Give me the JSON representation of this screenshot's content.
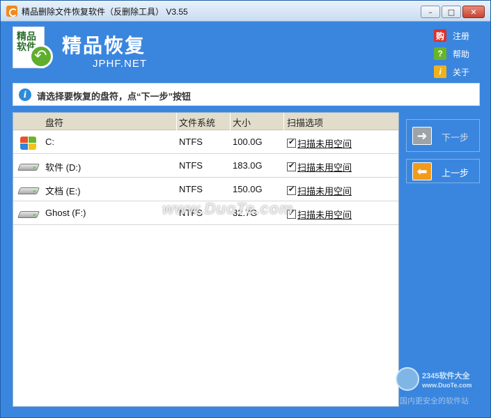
{
  "window": {
    "title": "精品删除文件恢复软件（反删除工具） V3.55"
  },
  "header": {
    "logo_text": "精品软件",
    "brand": "精品恢复",
    "brand_sub": "JPHF.NET",
    "links": [
      {
        "label": "注册",
        "icon": "cart-icon",
        "glyph": "购"
      },
      {
        "label": "帮助",
        "icon": "help-icon",
        "glyph": "?"
      },
      {
        "label": "关于",
        "icon": "about-icon",
        "glyph": "i"
      }
    ]
  },
  "info": {
    "text": "请选择要恢复的盘符，点“下一步”按钮",
    "glyph": "i"
  },
  "table": {
    "columns": [
      "盘符",
      "文件系统",
      "大小",
      "扫描选项"
    ],
    "rows": [
      {
        "drive": "C:",
        "fs": "NTFS",
        "size": "100.0G",
        "scan_label": "扫描未用空间",
        "checked": true,
        "icon": "windows-drive-icon"
      },
      {
        "drive": "软件 (D:)",
        "fs": "NTFS",
        "size": "183.0G",
        "scan_label": "扫描未用空间",
        "checked": true,
        "icon": "hard-drive-icon"
      },
      {
        "drive": "文档 (E:)",
        "fs": "NTFS",
        "size": "150.0G",
        "scan_label": "扫描未用空间",
        "checked": true,
        "icon": "hard-drive-icon"
      },
      {
        "drive": "Ghost (F:)",
        "fs": "NTFS",
        "size": "32.7G",
        "scan_label": "扫描未用空间",
        "checked": true,
        "icon": "hard-drive-icon"
      }
    ]
  },
  "buttons": {
    "next": "下一步",
    "prev": "上一步"
  },
  "watermark": "www.DuoTe.com",
  "corner_logo": {
    "brand": "2345软件大全",
    "site": "www.DuoTe.com",
    "slogan": "国内更安全的软件站"
  },
  "colors": {
    "window_bg": "#3a86df",
    "header_row": "#e1ddca",
    "prev_button_icon": "#f19a1b"
  }
}
